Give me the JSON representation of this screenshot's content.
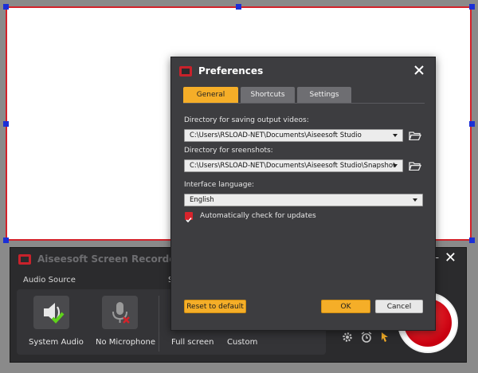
{
  "recorder": {
    "title": "Aiseesoft Screen Recorder",
    "audio_source_label": "Audio Source",
    "screen_label_fragment": "S",
    "extra_label": "–",
    "sources": [
      {
        "label": "System Audio"
      },
      {
        "label": "No Microphone"
      },
      {
        "label": "Full screen"
      },
      {
        "label": "Custom"
      }
    ],
    "close_label": "✕"
  },
  "dialog": {
    "title": "Preferences",
    "tabs": [
      {
        "label": "General",
        "active": true
      },
      {
        "label": "Shortcuts",
        "active": false
      },
      {
        "label": "Settings",
        "active": false
      }
    ],
    "output_dir_label": "Directory for saving output videos:",
    "output_dir_value": "C:\\Users\\RSLOAD-NET\\Documents\\Aiseesoft Studio",
    "screenshot_dir_label": "Directory for sreenshots:",
    "screenshot_dir_value": "C:\\Users\\RSLOAD-NET\\Documents\\Aiseesoft Studio\\Snapshot",
    "language_label": "Interface language:",
    "language_value": "English",
    "auto_update_label": "Automatically check for updates",
    "auto_update_checked": true,
    "reset_label": "Reset to default",
    "ok_label": "OK",
    "cancel_label": "Cancel"
  },
  "colors": {
    "accent": "#f5ae28",
    "record_red": "#d3222a",
    "handle_blue": "#1b2fd6",
    "dialog_bg": "#3d3d40"
  }
}
